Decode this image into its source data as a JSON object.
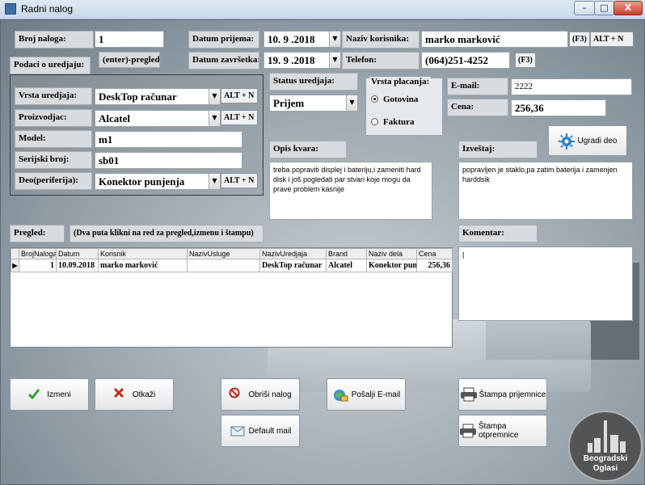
{
  "window": {
    "title": "Radni nalog",
    "minimize": "–",
    "maximize": "□",
    "close": "X"
  },
  "header": {
    "broj_naloga_label": "Broj naloga:",
    "broj_naloga_value": "1",
    "datum_prijema_label": "Datum prijema:",
    "datum_prijema_value": "10. 9 .2018",
    "naziv_korisnika_label": "Naziv korisnika:",
    "naziv_korisnika_value": "marko marković",
    "f3_key_1": "(F3)",
    "alt_n_key_1": "ALT + N",
    "podaci_label": "Podaci o uredjaju:",
    "enter_pregled_label": "(enter)-pregled",
    "datum_zavrsetka_label": "Datum završetka:",
    "datum_zavrsetka_value": "19. 9 .2018",
    "telefon_label": "Telefon:",
    "telefon_value": "(064)251-4252",
    "f3_key_2": "(F3)"
  },
  "device": {
    "vrsta_label": "Vrsta uredjaja:",
    "vrsta_value": "DeskTop računar",
    "vrsta_hotkey": "ALT + N",
    "proizvodjac_label": "Proizvodjac:",
    "proizvodjac_value": "Alcatel",
    "proizvodjac_hotkey": "ALT + N",
    "model_label": "Model:",
    "model_value": "m1",
    "serijski_label": "Serijski broj:",
    "serijski_value": "sb01",
    "deo_label": "Deo(periferija):",
    "deo_value": "Konektor punjenja",
    "deo_hotkey": "ALT + N"
  },
  "status": {
    "label": "Status uredjaja:",
    "value": "Prijem"
  },
  "payment": {
    "title": "Vrsta placanja:",
    "option1": "Gotovina",
    "option2": "Faktura"
  },
  "contact": {
    "email_label": "E-mail:",
    "email_value": "2222",
    "cena_label": "Cena:",
    "cena_value": "256,36"
  },
  "report": {
    "ugradi_label": "Ugradi deo",
    "opis_label": "Opis kvara:",
    "opis_text": "treba popraviti displej i bateriju,i zameniti hard disk i još pogledati par stvari koje mogu da prave problem kasnije",
    "izvestaj_label": "Izveštaj:",
    "izvestaj_text": "popravljen je staklo,pa zatim baterija i zamenjen harddsik",
    "komentar_label": "Komentar:"
  },
  "pregled": {
    "label": "Pregled:",
    "hint": "(Dva puta klikni na red za pregled,izmenu i štampu)"
  },
  "table": {
    "headers": [
      "BrojNaloga",
      "Datum",
      "Korisnik",
      "NazivUsluge",
      "NazivUredjaja",
      "Brand",
      "Naziv dela",
      "Cena"
    ],
    "rows": [
      [
        "1",
        "10.09.2018",
        "marko marković",
        "",
        "DeskTop računar",
        "Alcatel",
        "Konektor pun",
        "256,36"
      ]
    ]
  },
  "buttons": {
    "izmeni": "Izmeni",
    "otkazi": "Otkaži",
    "obrisi": "Obriši nalog",
    "posalji": "Pošalji E-mail",
    "stampa_prijem": "Štampa  prijemnice",
    "default_mail": "Default mail",
    "stampa_otprem": "Štampa otpremnice"
  },
  "watermark": {
    "line1": "Beogradski",
    "line2": "Oglasi"
  },
  "colors": {
    "accent_check": "#2e9e2e",
    "accent_cancel": "#c0281a",
    "accent_gear": "#2b7fd1"
  }
}
